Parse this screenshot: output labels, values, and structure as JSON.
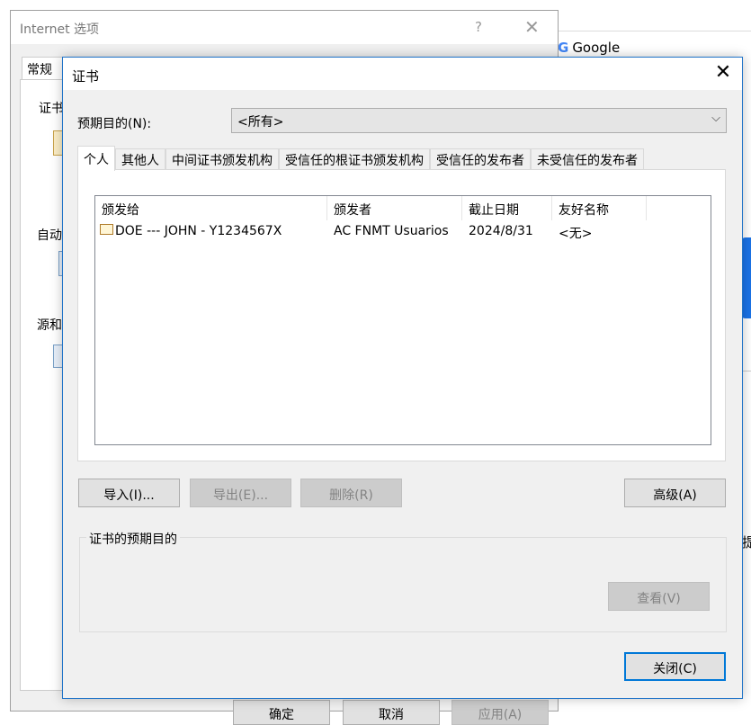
{
  "browser": {
    "google_label": "Google",
    "side_char": "提"
  },
  "inet_options": {
    "title": "Internet 选项",
    "help_glyph": "?",
    "close_glyph": "✕",
    "tab_general": "常规",
    "section_cert": "证书",
    "section_auto": "自动",
    "section_source": "源和",
    "ok_label": "确定",
    "cancel_label": "取消",
    "apply_label": "应用(A)"
  },
  "cert_dialog": {
    "title": "证书",
    "close_glyph": "✕",
    "purpose_label": "预期目的(N):",
    "purpose_value": "<所有>",
    "tabs": [
      {
        "label": "个人"
      },
      {
        "label": "其他人"
      },
      {
        "label": "中间证书颁发机构"
      },
      {
        "label": "受信任的根证书颁发机构"
      },
      {
        "label": "受信任的发布者"
      },
      {
        "label": "未受信任的发布者"
      }
    ],
    "columns": [
      "颁发给",
      "颁发者",
      "截止日期",
      "友好名称"
    ],
    "rows": [
      {
        "issued_to": "DOE --- JOHN - Y1234567X",
        "issuer": "AC FNMT Usuarios",
        "expires": "2024/8/31",
        "friendly": "<无>"
      }
    ],
    "import_label": "导入(I)...",
    "export_label": "导出(E)...",
    "remove_label": "删除(R)",
    "advanced_label": "高级(A)",
    "purposes_group_label": "证书的预期目的",
    "view_label": "查看(V)",
    "close_label": "关闭(C)"
  },
  "colors": {
    "accent": "#0078d7",
    "dialog_border": "#1f73c8",
    "window_bg": "#f0f0f0"
  }
}
